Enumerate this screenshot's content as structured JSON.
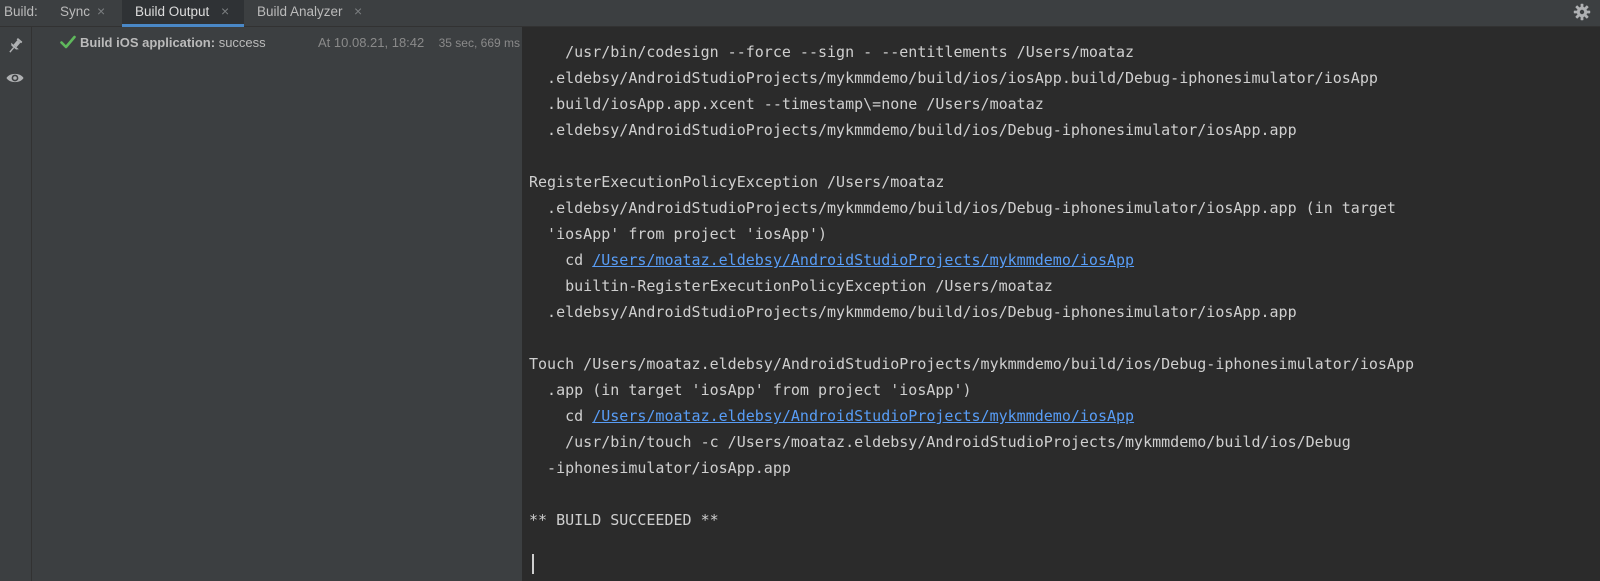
{
  "tabbar": {
    "prefix": "Build:",
    "tabs": [
      {
        "label": "Sync",
        "closable": true,
        "active": false
      },
      {
        "label": "Build Output",
        "closable": true,
        "active": true
      },
      {
        "label": "Build Analyzer",
        "closable": true,
        "active": false
      }
    ],
    "close_glyph": "×",
    "settings_icon": "gear-icon"
  },
  "toolstrip": {
    "buttons": [
      "pin-icon",
      "eye-icon"
    ]
  },
  "tree": {
    "status_icon": "check-icon",
    "status_color": "#5fb85c",
    "title": "Build iOS application:",
    "status": "success",
    "time": "At 10.08.21, 18:42",
    "duration": "35 sec, 669 ms"
  },
  "console": {
    "lines": [
      {
        "text": "    /usr/bin/codesign --force --sign - --entitlements /Users/moataz"
      },
      {
        "text": "  .eldebsy/AndroidStudioProjects/mykmmdemo/build/ios/iosApp.build/Debug-iphonesimulator/iosApp"
      },
      {
        "text": "  .build/iosApp.app.xcent --timestamp\\=none /Users/moataz"
      },
      {
        "text": "  .eldebsy/AndroidStudioProjects/mykmmdemo/build/ios/Debug-iphonesimulator/iosApp.app"
      },
      {
        "text": ""
      },
      {
        "text": "RegisterExecutionPolicyException /Users/moataz"
      },
      {
        "text": "  .eldebsy/AndroidStudioProjects/mykmmdemo/build/ios/Debug-iphonesimulator/iosApp.app (in target"
      },
      {
        "text": "  'iosApp' from project 'iosApp')"
      },
      {
        "prefix": "    cd ",
        "link": "/Users/moataz.eldebsy/AndroidStudioProjects/mykmmdemo/iosApp"
      },
      {
        "text": "    builtin-RegisterExecutionPolicyException /Users/moataz"
      },
      {
        "text": "  .eldebsy/AndroidStudioProjects/mykmmdemo/build/ios/Debug-iphonesimulator/iosApp.app"
      },
      {
        "text": ""
      },
      {
        "text": "Touch /Users/moataz.eldebsy/AndroidStudioProjects/mykmmdemo/build/ios/Debug-iphonesimulator/iosApp"
      },
      {
        "text": "  .app (in target 'iosApp' from project 'iosApp')"
      },
      {
        "prefix": "    cd ",
        "link": "/Users/moataz.eldebsy/AndroidStudioProjects/mykmmdemo/iosApp"
      },
      {
        "text": "    /usr/bin/touch -c /Users/moataz.eldebsy/AndroidStudioProjects/mykmmdemo/build/ios/Debug"
      },
      {
        "text": "  -iphonesimulator/iosApp.app"
      },
      {
        "text": ""
      },
      {
        "text": "** BUILD SUCCEEDED **"
      },
      {
        "text": ""
      }
    ]
  },
  "colors": {
    "link": "#589df6",
    "active_tab_underline": "#4a88c7",
    "panel_bg": "#3c3f41",
    "console_bg": "#2b2b2b"
  }
}
